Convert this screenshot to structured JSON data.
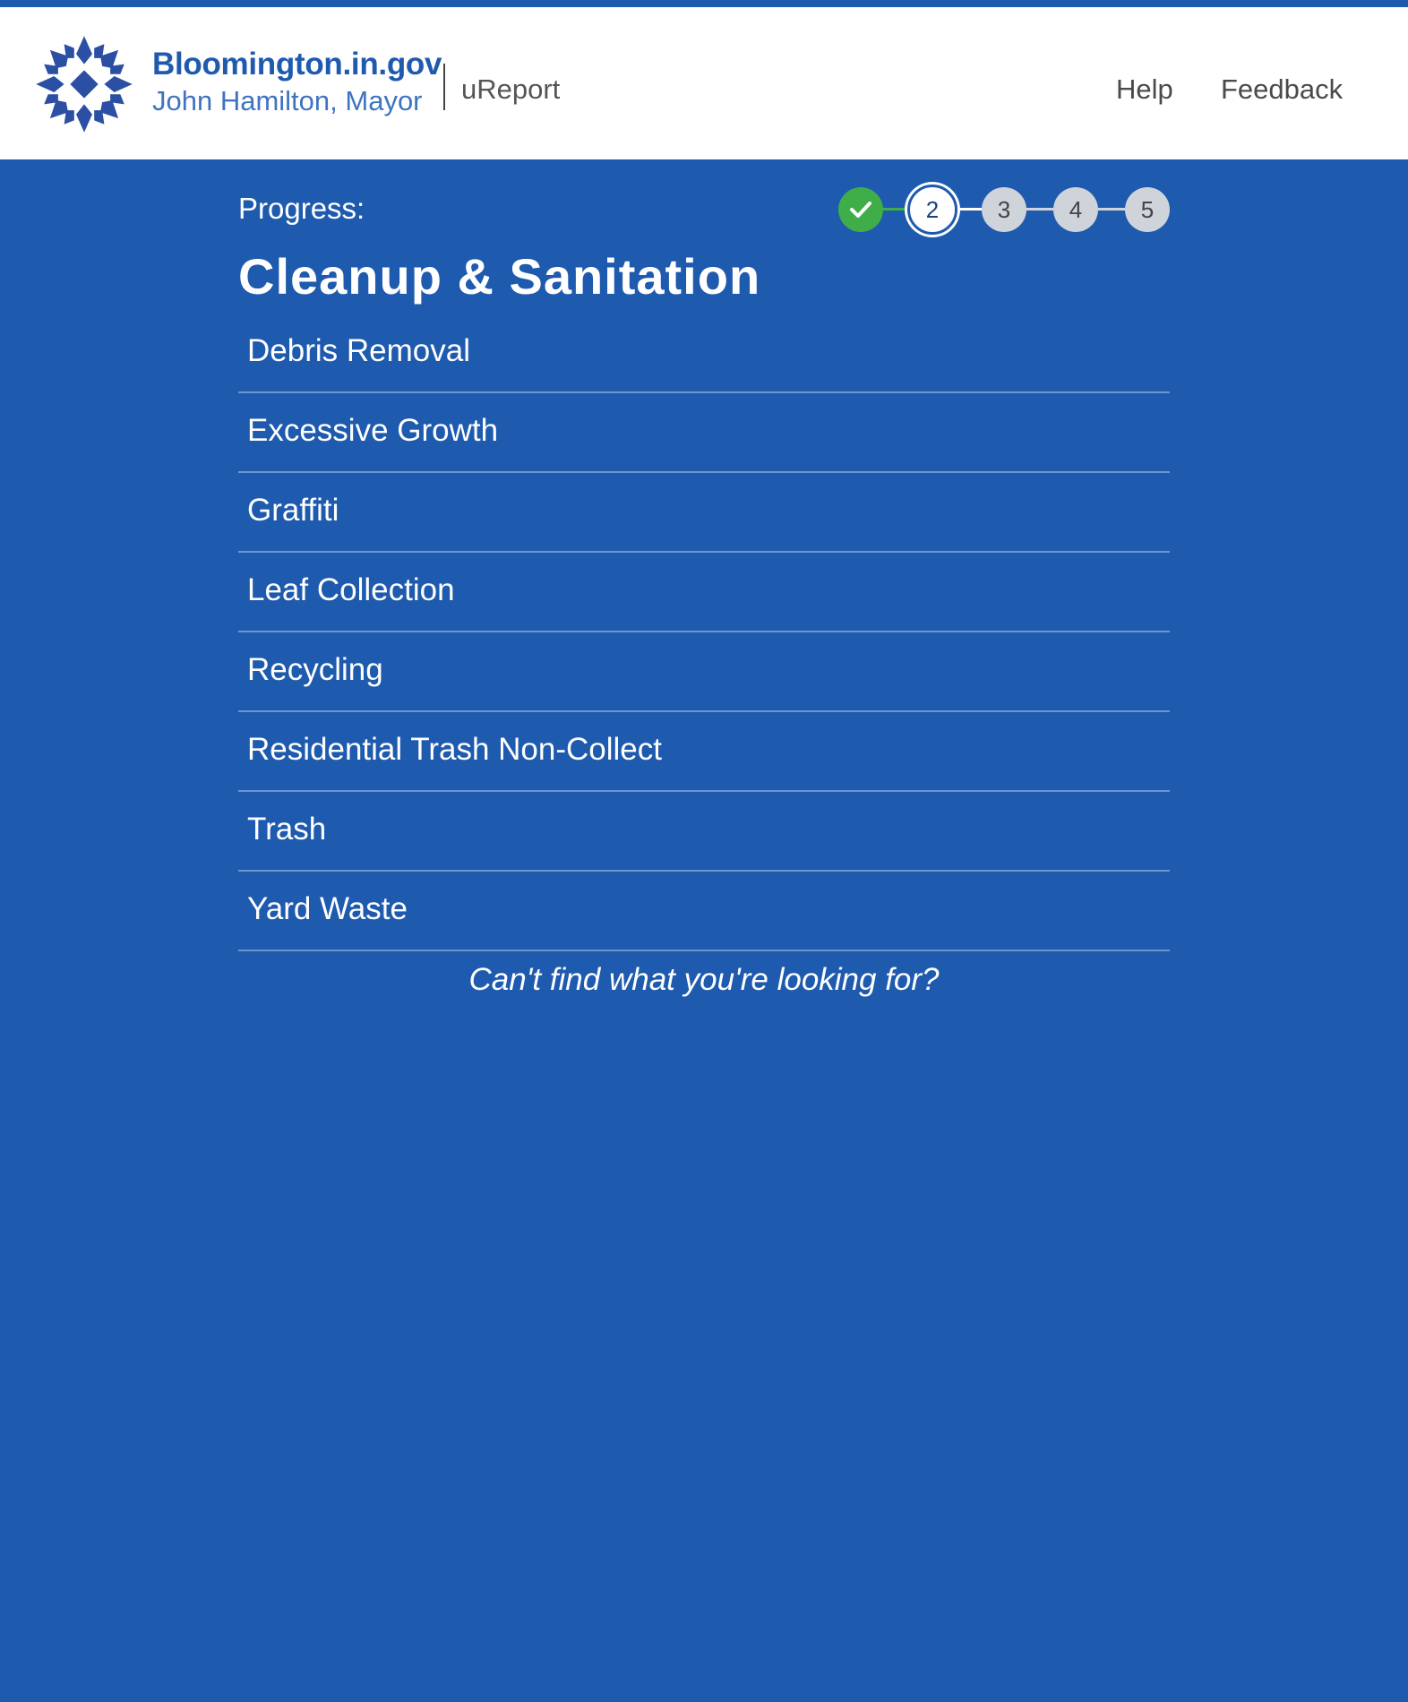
{
  "header": {
    "brand_name": "Bloomington.in.gov",
    "brand_subtitle": "John Hamilton, Mayor",
    "app_name": "uReport",
    "logo_icon": "city-star-logo-icon",
    "nav": {
      "help": "Help",
      "feedback": "Feedback"
    }
  },
  "progress": {
    "label": "Progress:",
    "current_step": 2,
    "total_steps": 5,
    "steps": [
      {
        "label": "",
        "state": "done",
        "icon": "checkmark-icon"
      },
      {
        "label": "2",
        "state": "current"
      },
      {
        "label": "3",
        "state": "todo"
      },
      {
        "label": "4",
        "state": "todo"
      },
      {
        "label": "5",
        "state": "todo"
      }
    ]
  },
  "category": {
    "title": "Cleanup & Sanitation"
  },
  "items": [
    "Debris Removal",
    "Excessive Growth",
    "Graffiti",
    "Leaf Collection",
    "Recycling",
    "Residential Trash Non-Collect",
    "Trash",
    "Yard Waste"
  ],
  "help_link": "Can't find what you're looking for?",
  "colors": {
    "primary_blue": "#1e5aae",
    "brand_blue": "#1e5aae",
    "step_done_green": "#3fae49",
    "step_todo_gray": "#cfd3da",
    "divider": "#6f95cf"
  }
}
